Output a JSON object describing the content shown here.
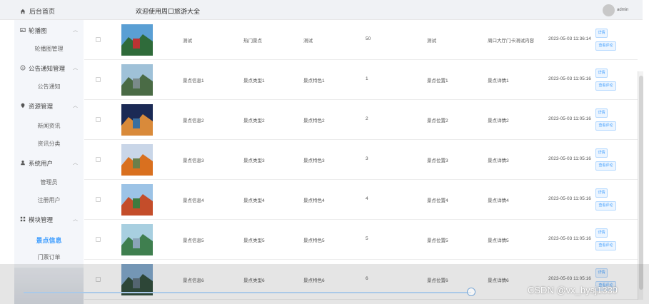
{
  "header": {
    "home_label": "后台首页",
    "welcome": "欢迎使用周口旅游大全",
    "user": "admin"
  },
  "sidebar": {
    "groups": [
      {
        "label": "轮播图",
        "items": [
          "轮播图管理"
        ]
      },
      {
        "label": "公告通知管理",
        "items": [
          "公告通知"
        ]
      },
      {
        "label": "资源管理",
        "items": [
          "新闻资讯",
          "资讯分类"
        ]
      },
      {
        "label": "系统用户",
        "items": [
          "管理员",
          "注册用户"
        ]
      },
      {
        "label": "模块管理",
        "items": [
          "景点信息",
          "门票订单"
        ]
      }
    ],
    "active_item": "景点信息"
  },
  "table": {
    "rows": [
      {
        "name": "测试",
        "type": "热门景点",
        "feature": "测试",
        "count": "50",
        "location": "测试",
        "detail": "周口大厅门卡测试内容",
        "time": "2023-05-03 11:36:14",
        "btn1": "详情",
        "btn2": "查看评论"
      },
      {
        "name": "景点信息1",
        "type": "景点类型1",
        "feature": "景点特色1",
        "count": "1",
        "location": "景点位置1",
        "detail": "景点详情1",
        "time": "2023-05-03 11:05:16",
        "btn1": "详情",
        "btn2": "查看评论"
      },
      {
        "name": "景点信息2",
        "type": "景点类型2",
        "feature": "景点特色2",
        "count": "2",
        "location": "景点位置2",
        "detail": "景点详情2",
        "time": "2023-05-03 11:05:16",
        "btn1": "详情",
        "btn2": "查看评论"
      },
      {
        "name": "景点信息3",
        "type": "景点类型3",
        "feature": "景点特色3",
        "count": "3",
        "location": "景点位置3",
        "detail": "景点详情3",
        "time": "2023-05-03 11:05:16",
        "btn1": "详情",
        "btn2": "查看评论"
      },
      {
        "name": "景点信息4",
        "type": "景点类型4",
        "feature": "景点特色4",
        "count": "4",
        "location": "景点位置4",
        "detail": "景点详情4",
        "time": "2023-05-03 11:05:16",
        "btn1": "详情",
        "btn2": "查看评论"
      },
      {
        "name": "景点信息5",
        "type": "景点类型5",
        "feature": "景点特色5",
        "count": "5",
        "location": "景点位置5",
        "detail": "景点详情5",
        "time": "2023-05-03 11:05:16",
        "btn1": "详情",
        "btn2": "查看评论"
      },
      {
        "name": "景点信息6",
        "type": "景点类型6",
        "feature": "景点特色6",
        "count": "6",
        "location": "景点位置6",
        "detail": "景点详情6",
        "time": "2023-05-03 11:05:16",
        "btn1": "详情",
        "btn2": "查看评论"
      }
    ]
  },
  "watermark": "CSDN @vx_bysj1330",
  "colors": {
    "accent": "#409eff",
    "sidebar_bg": "#f4f6fa",
    "topbar_bg": "#f0f2f5"
  }
}
